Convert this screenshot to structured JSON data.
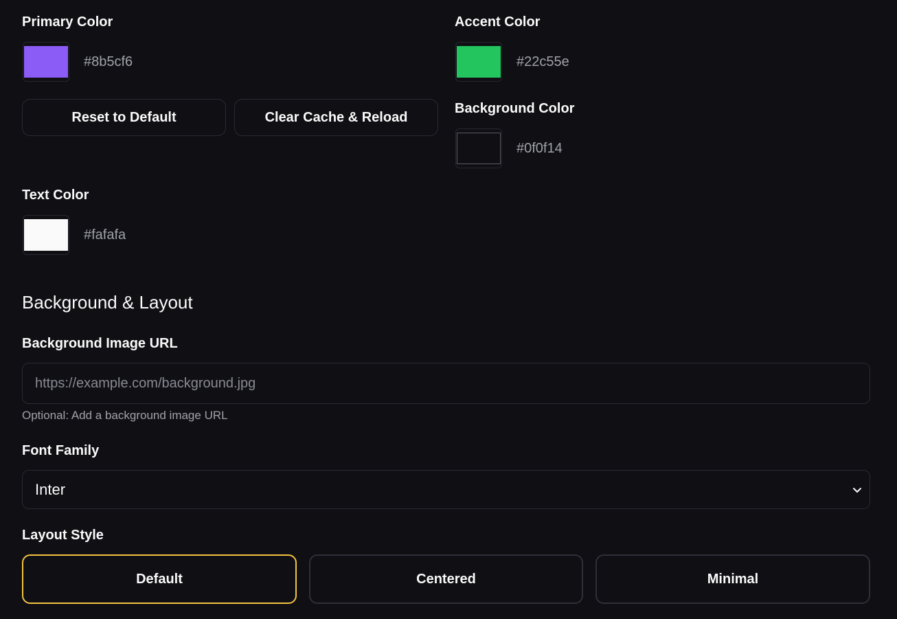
{
  "colors": {
    "primary": {
      "label": "Primary Color",
      "value": "#8b5cf6"
    },
    "accent": {
      "label": "Accent Color",
      "value": "#22c55e"
    },
    "background": {
      "label": "Background Color",
      "value": "#0f0f14"
    },
    "text": {
      "label": "Text Color",
      "value": "#fafafa"
    }
  },
  "actions": {
    "reset_label": "Reset to Default",
    "clear_cache_label": "Clear Cache & Reload"
  },
  "background_layout": {
    "section_title": "Background & Layout",
    "bg_image": {
      "label": "Background Image URL",
      "value": "",
      "placeholder": "https://example.com/background.jpg",
      "hint": "Optional: Add a background image URL"
    },
    "font_family": {
      "label": "Font Family",
      "selected": "Inter"
    },
    "layout_style": {
      "label": "Layout Style",
      "options": [
        "Default",
        "Centered",
        "Minimal"
      ],
      "selected": "Default"
    }
  },
  "theme": {
    "selected_border": "#f5c542",
    "border": "#2a2a33"
  },
  "icons": {
    "select_chevron": "chevron-down-icon"
  }
}
